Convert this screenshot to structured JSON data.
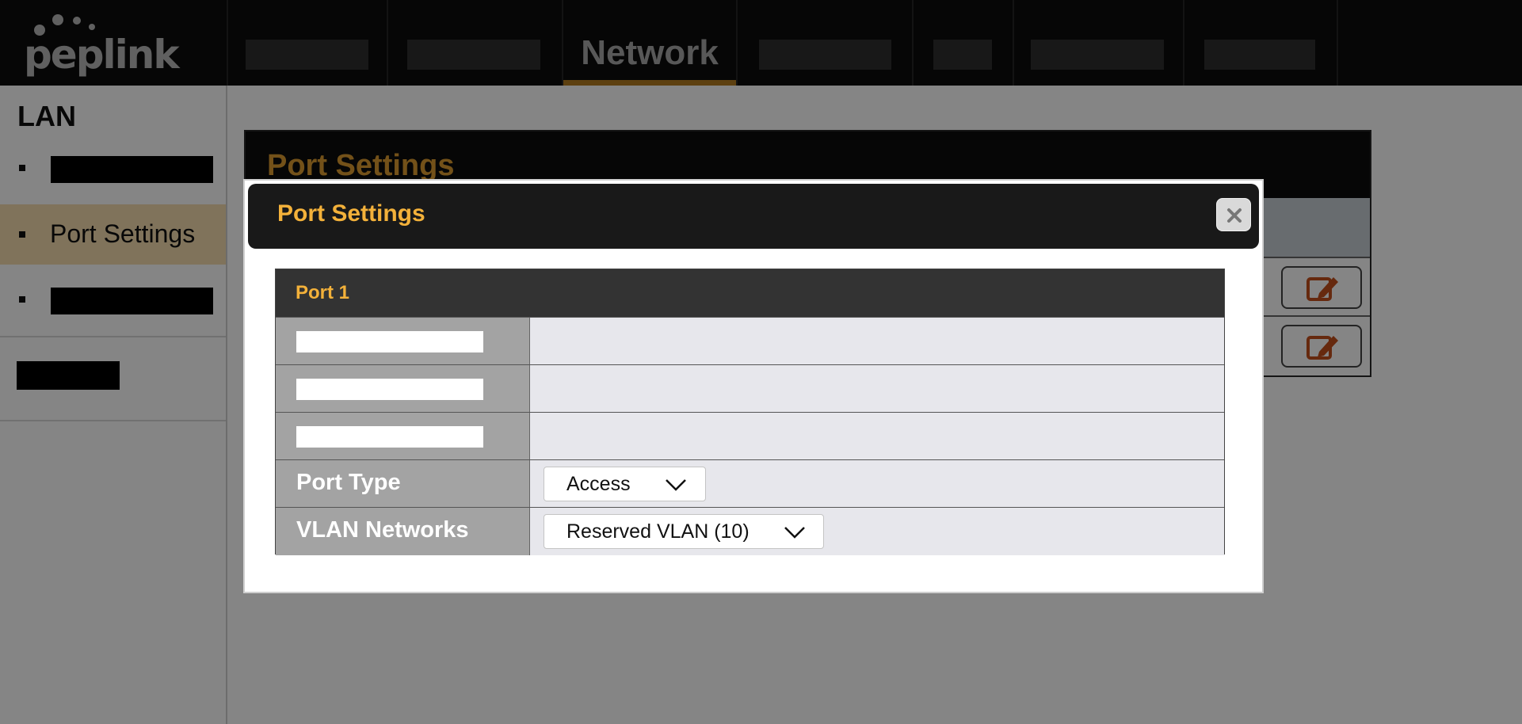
{
  "brand": {
    "name": "peplink"
  },
  "nav": {
    "active_tab": "Network"
  },
  "sidebar": {
    "section": "LAN",
    "active_item": "Port Settings"
  },
  "background_panel": {
    "title": "Port Settings"
  },
  "modal": {
    "title": "Port Settings",
    "table_header": "Port 1",
    "port_type": {
      "label": "Port Type",
      "value": "Access"
    },
    "vlan_networks": {
      "label": "VLAN Networks",
      "value": "Reserved VLAN (10)"
    }
  },
  "colors": {
    "accent": "#f3b13a",
    "active_tab_underline": "#e8a024",
    "sidebar_active_bg": "#f6ddae",
    "edit_icon": "#c4501c"
  },
  "icons": [
    "peplink-logo",
    "edit-icon",
    "close-icon",
    "chevron-down-icon"
  ]
}
